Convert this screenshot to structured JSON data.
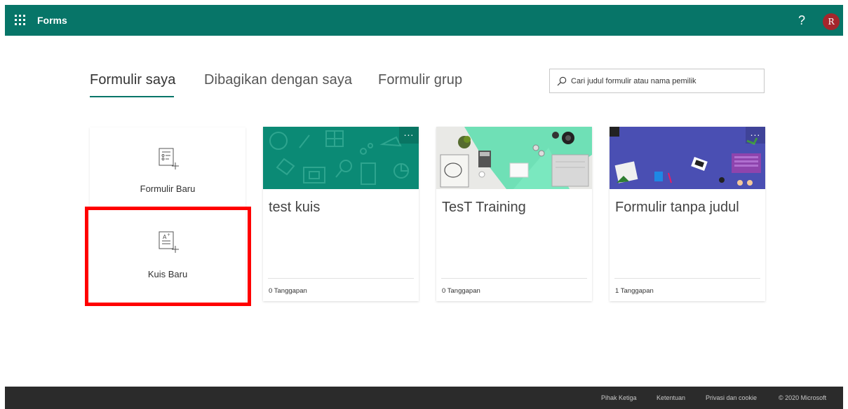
{
  "header": {
    "app_title": "Forms",
    "help_label": "?",
    "avatar_initial": "R",
    "bg_color": "#077568"
  },
  "tabs": [
    {
      "label": "Formulir saya",
      "active": true
    },
    {
      "label": "Dibagikan dengan saya",
      "active": false
    },
    {
      "label": "Formulir grup",
      "active": false
    }
  ],
  "search": {
    "placeholder": "Cari judul formulir atau nama pemilik",
    "value": ""
  },
  "new_tiles": {
    "new_form_label": "Formulir Baru",
    "new_quiz_label": "Kuis Baru"
  },
  "forms": [
    {
      "title": "test kuis",
      "responses": "0 Tanggapan",
      "more": "...",
      "theme": "teal-doodles"
    },
    {
      "title": "TesT Training",
      "responses": "0 Tanggapan",
      "more": "",
      "theme": "desk-photo"
    },
    {
      "title": "Formulir tanpa judul",
      "responses": "1 Tanggapan",
      "more": "...",
      "theme": "purple-desk"
    }
  ],
  "footer": {
    "links": [
      "Pihak Ketiga",
      "Ketentuan",
      "Privasi dan cookie"
    ],
    "copyright": "© 2020 Microsoft"
  },
  "colors": {
    "accent": "#077568",
    "highlight": "#ff0000",
    "footer_bg": "#2b2b2b"
  }
}
